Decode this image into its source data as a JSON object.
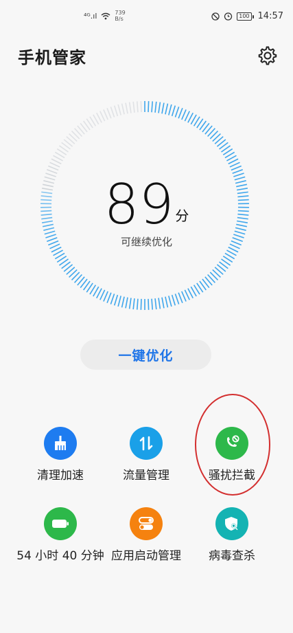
{
  "status_bar": {
    "signal_text": "⁴ᴳ.ıl",
    "speed_value": "739",
    "speed_unit": "B/s",
    "battery": "100",
    "time": "14:57"
  },
  "header": {
    "title": "手机管家",
    "settings_icon": "gear-icon"
  },
  "score": {
    "value": "89",
    "unit": "分",
    "subtitle": "可继续优化",
    "ring_color": "#3ea6ec"
  },
  "optimize_button": {
    "label": "一键优化",
    "color": "#1f75e8"
  },
  "tools": [
    {
      "label": "清理加速",
      "icon": "broom-icon",
      "color": "#1e7cf0"
    },
    {
      "label": "流量管理",
      "icon": "data-transfer-icon",
      "color": "#1aa0e8"
    },
    {
      "label": "骚扰拦截",
      "icon": "blocked-call-icon",
      "color": "#2db84a"
    },
    {
      "label": "54 小时 40 分钟",
      "icon": "battery-icon",
      "color": "#2db84a"
    },
    {
      "label": "应用启动管理",
      "icon": "toggle-switch-icon",
      "color": "#f5820f"
    },
    {
      "label": "病毒查杀",
      "icon": "shield-search-icon",
      "color": "#14b3b3"
    }
  ]
}
